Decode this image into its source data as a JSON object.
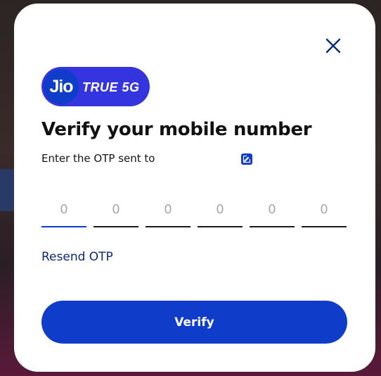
{
  "logo": {
    "jio": "Jio",
    "tagline": "TRUE 5G",
    "colors": {
      "badge": "#3535e0",
      "circle": "#0f3cc9"
    }
  },
  "modal": {
    "close_icon": "close-icon",
    "title": "Verify your mobile number",
    "subtitle": "Enter the OTP sent to",
    "edit_icon": "edit-icon"
  },
  "otp": {
    "placeholders": [
      "0",
      "0",
      "0",
      "0",
      "0",
      "0"
    ],
    "values": [
      "",
      "",
      "",
      "",
      "",
      ""
    ],
    "active_index": 0
  },
  "resend_label": "Resend OTP",
  "verify_label": "Verify",
  "colors": {
    "primary": "#0f3cc9",
    "link": "#0a2a78",
    "text": "#111111"
  }
}
